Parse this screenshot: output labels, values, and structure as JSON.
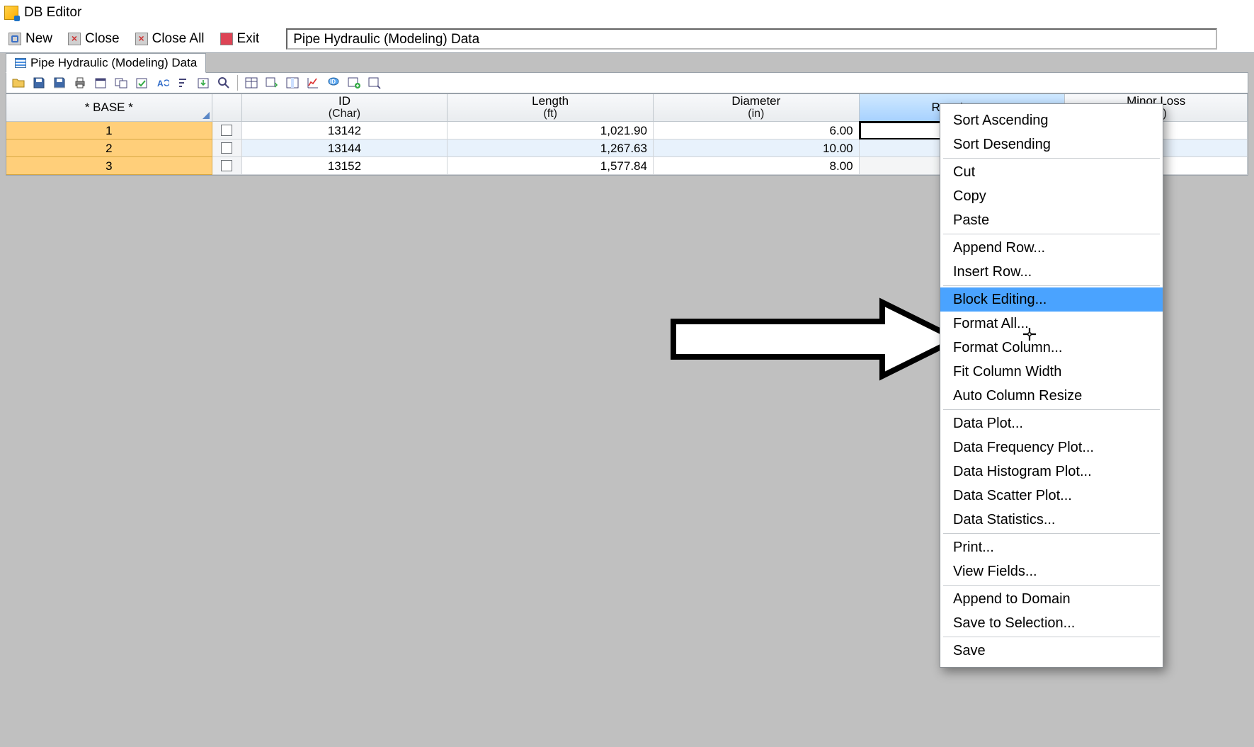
{
  "window": {
    "title": "DB Editor"
  },
  "menubar": {
    "new": "New",
    "close": "Close",
    "close_all": "Close All",
    "exit": "Exit",
    "field": "Pipe Hydraulic (Modeling) Data"
  },
  "tab": {
    "label": "Pipe Hydraulic (Modeling) Data"
  },
  "columns": {
    "rowheader": "* BASE *",
    "id": {
      "title": "ID",
      "sub": "(Char)"
    },
    "length": {
      "title": "Length",
      "sub": "(ft)"
    },
    "diameter": {
      "title": "Diameter",
      "sub": "(in)"
    },
    "roughness": {
      "title": "Roughness"
    },
    "minor": {
      "title": "Minor Loss",
      "sub": "ible)"
    }
  },
  "rows": [
    {
      "n": "1",
      "id": "13142",
      "length": "1,021.90",
      "diameter": "6.00"
    },
    {
      "n": "2",
      "id": "13144",
      "length": "1,267.63",
      "diameter": "10.00"
    },
    {
      "n": "3",
      "id": "13152",
      "length": "1,577.84",
      "diameter": "8.00"
    }
  ],
  "context_menu": {
    "groups": [
      [
        "Sort Ascending",
        "Sort Desending"
      ],
      [
        "Cut",
        "Copy",
        "Paste"
      ],
      [
        "Append Row...",
        "Insert Row..."
      ],
      [
        "Block Editing...",
        "Format All...",
        "Format Column...",
        "Fit Column Width",
        "Auto Column Resize"
      ],
      [
        "Data Plot...",
        "Data Frequency Plot...",
        "Data Histogram Plot...",
        "Data Scatter Plot...",
        "Data Statistics..."
      ],
      [
        "Print...",
        "View Fields..."
      ],
      [
        "Append to Domain",
        "Save to Selection..."
      ],
      [
        "Save"
      ]
    ],
    "highlighted": "Block Editing..."
  }
}
